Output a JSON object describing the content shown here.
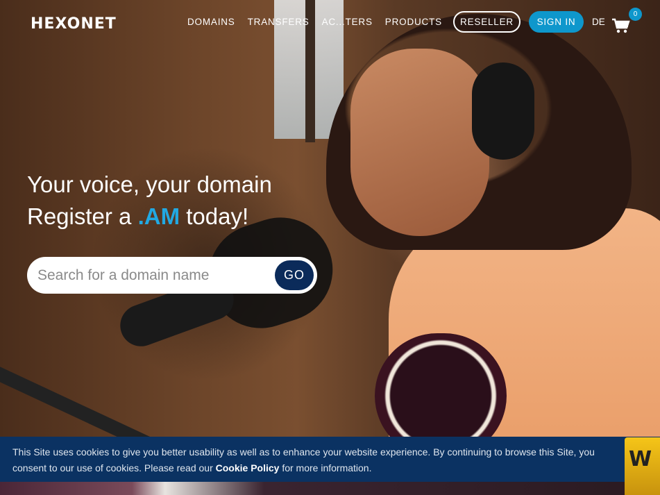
{
  "brand": {
    "logo": "HEXONET"
  },
  "nav": {
    "items": [
      "DOMAINS",
      "TRANSFERS",
      "AC...TERS",
      "PRODUCTS"
    ],
    "reseller_label": "RESELLER",
    "signin_label": "SIGN IN",
    "language": "DE",
    "cart_count": "0"
  },
  "hero": {
    "line1": "Your voice, your domain",
    "line2_prefix": "Register a ",
    "line2_tld": ".AM",
    "line2_suffix": " today!"
  },
  "search": {
    "placeholder": "Search for a domain name",
    "value": "",
    "button_label": "GO"
  },
  "cookie": {
    "text_before": "This Site uses cookies to give you better usability as well as to enhance your website experience. By continuing to browse this Site, you consent to our use of cookies. Please read our ",
    "link_label": "Cookie Policy",
    "text_after": " for more information."
  },
  "colors": {
    "accent": "#0e97cc",
    "tld": "#22a9e2",
    "go_button": "#0b2b5a",
    "cookie_bg": "#0b3262"
  }
}
